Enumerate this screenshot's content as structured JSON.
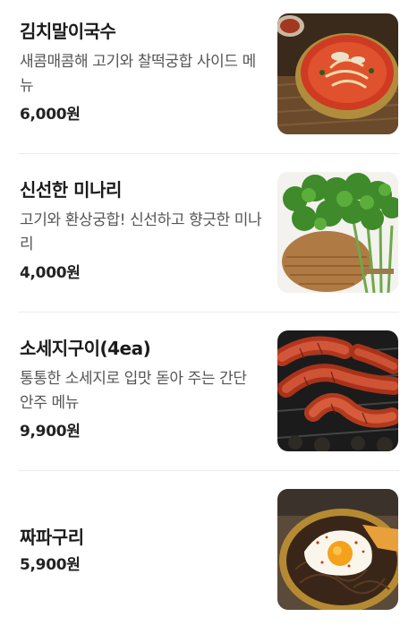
{
  "menu": {
    "items": [
      {
        "name": "김치말이국수",
        "description": "새콤매콤해 고기와 찰떡궁합 사이드 메뉴",
        "price": "6,000원",
        "image_icon": "kimchi-noodle-soup-photo"
      },
      {
        "name": "신선한 미나리",
        "description": "고기와 환상궁합! 신선하고 향긋한 미나리",
        "price": "4,000원",
        "image_icon": "water-parsley-photo"
      },
      {
        "name": "소세지구이(4ea)",
        "description": "통통한 소세지로 입맛 돋아 주는 간단 안주 메뉴",
        "price": "9,900원",
        "image_icon": "grilled-sausage-photo"
      },
      {
        "name": "짜파구리",
        "description": "",
        "price": "5,900원",
        "image_icon": "jjapaguri-photo"
      }
    ]
  }
}
